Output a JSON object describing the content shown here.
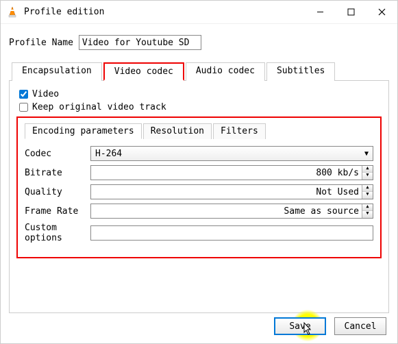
{
  "title": "Profile edition",
  "profile": {
    "label": "Profile Name",
    "value": "Video for Youtube SD"
  },
  "tabs": {
    "encapsulation": "Encapsulation",
    "video_codec": "Video codec",
    "audio_codec": "Audio codec",
    "subtitles": "Subtitles"
  },
  "video": {
    "checkbox_label": "Video",
    "keep_original_label": "Keep original video track"
  },
  "subtabs": {
    "encoding": "Encoding parameters",
    "resolution": "Resolution",
    "filters": "Filters"
  },
  "fields": {
    "codec": {
      "label": "Codec",
      "value": "H-264"
    },
    "bitrate": {
      "label": "Bitrate",
      "value": "800 kb/s"
    },
    "quality": {
      "label": "Quality",
      "value": "Not Used"
    },
    "frame_rate": {
      "label": "Frame Rate",
      "value": "Same as source"
    },
    "custom_options": {
      "label": "Custom options",
      "value": ""
    }
  },
  "buttons": {
    "save": "Save",
    "cancel": "Cancel"
  }
}
